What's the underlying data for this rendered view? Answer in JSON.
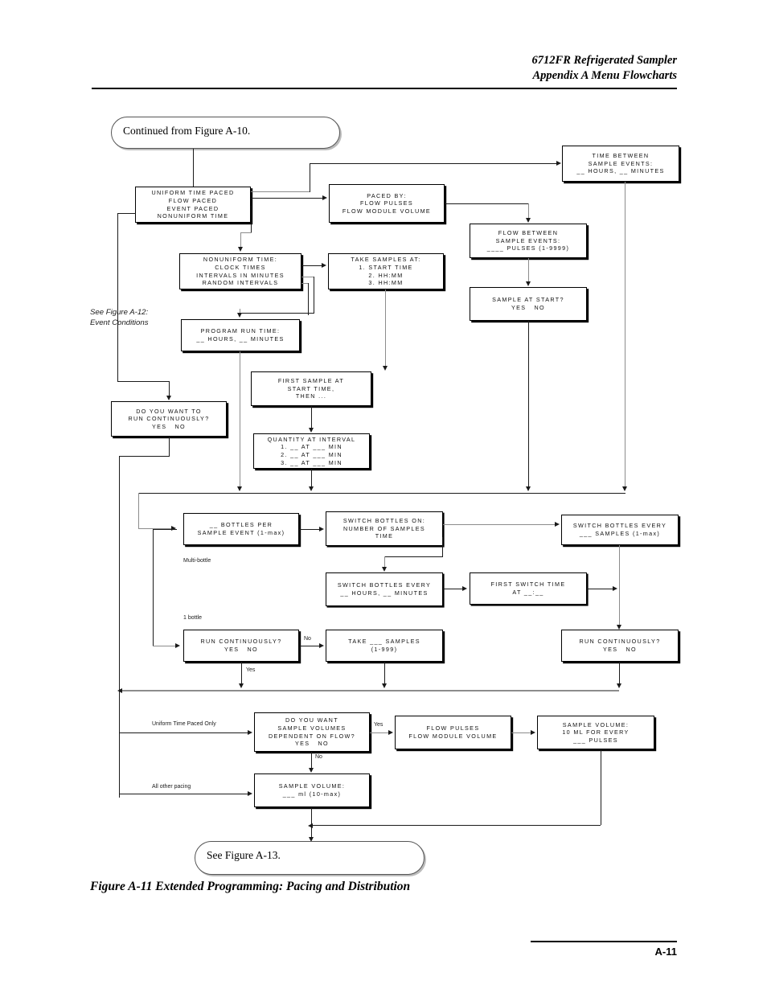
{
  "header": {
    "line1": "6712FR Refrigerated Sampler",
    "line2": "Appendix A  Menu Flowcharts"
  },
  "footer": {
    "page": "A-11"
  },
  "caption": "Figure A-11 Extended Programming: Pacing and Distribution",
  "terminators": {
    "start": "Continued from Figure A-10.",
    "end": "See Figure A-13."
  },
  "boxes": {
    "pacing_modes": "UNIFORM TIME PACED\nFLOW PACED\nEVENT PACED\nNONUNIFORM TIME",
    "paced_by": "PACED BY:\nFLOW PULSES\nFLOW MODULE VOLUME",
    "time_between": "TIME BETWEEN\nSAMPLE EVENTS:\n__ HOURS, __ MINUTES",
    "flow_between": "FLOW BETWEEN\nSAMPLE EVENTS:\n____ PULSES (1-9999)",
    "sample_at_start": "SAMPLE AT START?\nYES   NO",
    "nonuniform_time": "NONUNIFORM TIME:\nCLOCK TIMES\nINTERVALS IN MINUTES\nRANDOM INTERVALS",
    "take_samples_at": "TAKE SAMPLES AT:\n1. START TIME\n2. HH:MM\n3. HH:MM",
    "program_run_time": "PROGRAM RUN TIME:\n__ HOURS, __ MINUTES",
    "first_sample_at": "FIRST SAMPLE AT\nSTART TIME,\nTHEN ...",
    "quantity_at_interval": "QUANTITY AT INTERVAL\n1. __ AT ___ MIN\n2. __ AT ___ MIN\n3. __ AT ___ MIN",
    "run_continuously_top": "DO YOU WANT TO\nRUN CONTINUOUSLY?\nYES   NO",
    "bottles_per_event": "__ BOTTLES PER\nSAMPLE EVENT (1-max)",
    "switch_bottles_on": "SWITCH BOTTLES ON:\nNUMBER OF SAMPLES\nTIME",
    "switch_bottles_every_samples": "SWITCH BOTTLES EVERY\n___ SAMPLES (1-max)",
    "switch_bottles_every_time": "SWITCH BOTTLES EVERY\n__ HOURS, __ MINUTES",
    "first_switch_time": "FIRST SWITCH TIME\nAT __:__",
    "run_continuously_left": "RUN CONTINUOUSLY?\nYES   NO",
    "take_samples": "TAKE ___ SAMPLES\n(1-999)",
    "run_continuously_right": "RUN CONTINUOUSLY?\nYES   NO",
    "volumes_dependent_on_flow": "DO YOU WANT\nSAMPLE VOLUMES\nDEPENDENT ON FLOW?\nYES   NO",
    "flow_pulses_module": "FLOW PULSES\nFLOW MODULE VOLUME",
    "sample_volume_flow": "SAMPLE VOLUME:\n10 ML FOR EVERY\n___ PULSES",
    "sample_volume_ml": "SAMPLE VOLUME:\n___ ml (10-max)"
  },
  "annotations": {
    "see_figure_a12": "See Figure A-12:\nEvent Conditions",
    "multi_bottle": "Multi-bottle",
    "one_bottle": "1 bottle",
    "no_label_1": "No",
    "yes_label_1": "Yes",
    "uniform_time_paced_only": "Uniform Time Paced Only",
    "all_other_pacing": "All other pacing",
    "yes_label_2": "Yes",
    "no_label_2": "No"
  }
}
